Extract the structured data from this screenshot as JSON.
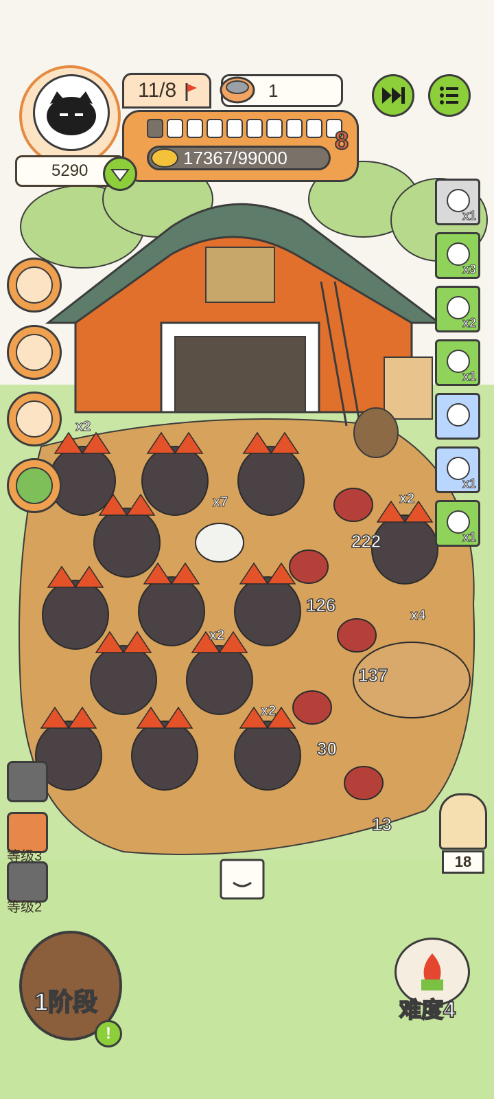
{
  "hud": {
    "score": "5290",
    "turn": "11/8",
    "bowl_count": "1",
    "level": "8",
    "gold": "17367/99000",
    "xp_segments_total": 9,
    "xp_segments_filled": 1
  },
  "items": [
    {
      "count": "x1",
      "bg": "#d9d9d9",
      "icon": "winged-bottle-icon"
    },
    {
      "count": "x3",
      "bg": "#8fd35a",
      "icon": "hourglass-fence-icon"
    },
    {
      "count": "x2",
      "bg": "#8fd35a",
      "icon": "house-icon"
    },
    {
      "count": "x1",
      "bg": "#8fd35a",
      "icon": "boar-icon"
    },
    {
      "count": "",
      "bg": "#b9d6ff",
      "icon": "sheep-icon"
    },
    {
      "count": "x1",
      "bg": "#b9d6ff",
      "icon": "scythe-icon"
    },
    {
      "count": "x1",
      "bg": "#8fd35a",
      "icon": "egg-nest-icon"
    }
  ],
  "multipliers": {
    "m1": "x2",
    "m2": "x7",
    "m3": "x2",
    "m4": "x2",
    "m5": "x2",
    "m6": "x4"
  },
  "meat": {
    "a": "222",
    "b": "126",
    "c": "137",
    "d": "30",
    "e": "13"
  },
  "skills": {
    "level3": "等级3",
    "level2": "等级2"
  },
  "stage": "1阶段",
  "owl_count": "18",
  "difficulty": "难度4",
  "colors": {
    "grass": "#bfe09a",
    "dirt": "#d6a25c",
    "barn": "#e0702b",
    "accent": "#8ccf3a"
  }
}
